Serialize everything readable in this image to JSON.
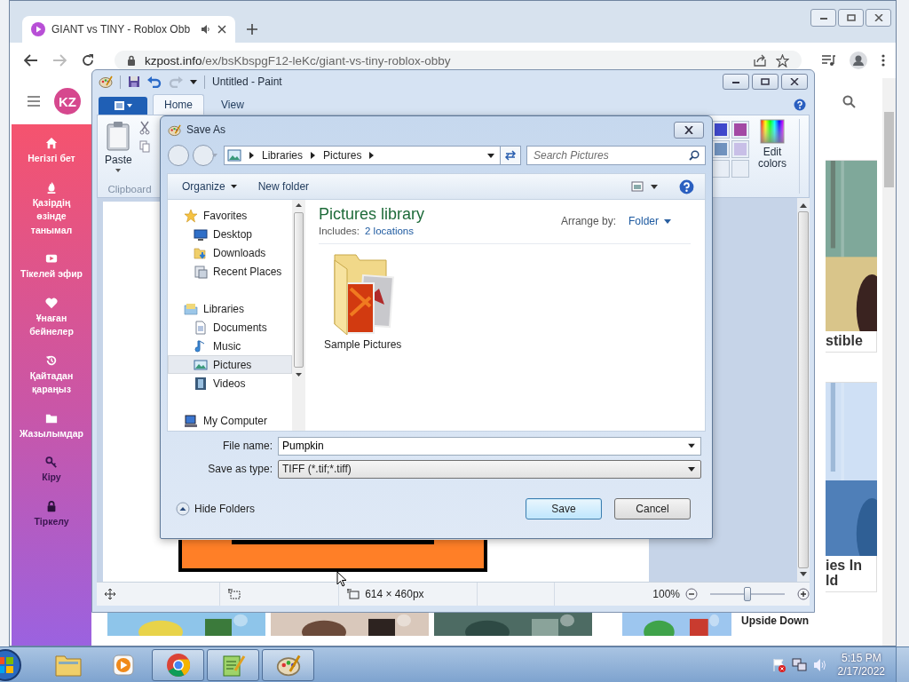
{
  "browser": {
    "tab": {
      "title": "GIANT vs TINY - Roblox Obb"
    },
    "address": {
      "host": "kzpost.info",
      "path": "/ex/bsKbspgF12-leKc/giant-vs-tiny-roblox-obby"
    },
    "site": {
      "logo": "KZ",
      "sidebar": [
        {
          "kind": "home",
          "label": "Негізгі бет"
        },
        {
          "kind": "trending",
          "label": "Қазірдің өзінде танымал"
        },
        {
          "kind": "live",
          "label": "Тікелей эфир"
        },
        {
          "kind": "liked",
          "label": "Ұнаған бейнелер"
        },
        {
          "kind": "history",
          "label": "Қайтадан қараңыз"
        },
        {
          "kind": "subscriptions",
          "label": "Жазылымдар"
        },
        {
          "kind": "login",
          "label": "Кіру"
        },
        {
          "kind": "register",
          "label": "Тіркелу"
        }
      ],
      "cards": [
        {
          "lines": [
            "stible"
          ]
        },
        {
          "lines": [
            "ies In",
            "ld"
          ]
        }
      ],
      "bottom_caption": "Upside Down"
    }
  },
  "paint": {
    "title": "Untitled - Paint",
    "tabs": [
      {
        "label": "Home",
        "selected": true
      },
      {
        "label": "View",
        "selected": false
      }
    ],
    "clipboard": {
      "paste": "Paste",
      "group": "Clipboard"
    },
    "palette": [
      {
        "color": "#3f48cc"
      },
      {
        "color": "#a349a4"
      },
      {
        "color": "#7092be"
      },
      {
        "color": "#c8bfe7"
      }
    ],
    "edit_colors": "Edit colors",
    "status": {
      "size": "614 × 460px",
      "zoom": "100%",
      "zoom_slider": {
        "level": 0.5
      }
    }
  },
  "save_dialog": {
    "title": "Save As",
    "path": [
      "Libraries",
      "Pictures"
    ],
    "search_placeholder": "Search Pictures",
    "toolbar": [
      "Organize",
      "New folder"
    ],
    "nav": [
      {
        "kind": "favorites",
        "label": "Favorites",
        "selected": false,
        "children": [
          {
            "kind": "desktop",
            "label": "Desktop",
            "selected": false
          },
          {
            "kind": "downloads",
            "label": "Downloads",
            "selected": false
          },
          {
            "kind": "recent",
            "label": "Recent Places",
            "selected": false
          }
        ]
      },
      {
        "kind": "libraries",
        "label": "Libraries",
        "selected": false,
        "children": [
          {
            "kind": "documents",
            "label": "Documents",
            "selected": false
          },
          {
            "kind": "music",
            "label": "Music",
            "selected": false
          },
          {
            "kind": "pictures",
            "label": "Pictures",
            "selected": true
          },
          {
            "kind": "videos",
            "label": "Videos",
            "selected": false
          }
        ]
      },
      {
        "kind": "computer",
        "label": "My Computer",
        "selected": false
      }
    ],
    "library": {
      "title": "Pictures library",
      "includes_label": "Includes:",
      "includes_link": "2 locations",
      "arrange_label": "Arrange by:",
      "arrange_value": "Folder"
    },
    "items": [
      {
        "kind": "folder",
        "name": "Sample Pictures"
      }
    ],
    "file_name": {
      "label": "File name:",
      "value": "Pumpkin"
    },
    "save_type": {
      "label": "Save as type:",
      "value": "TIFF (*.tif;*.tiff)"
    },
    "hide_folders": "Hide Folders",
    "buttons": [
      {
        "kind": "primary",
        "label": "Save"
      },
      {
        "kind": "secondary",
        "label": "Cancel"
      }
    ]
  },
  "taskbar": {
    "apps": [
      {
        "kind": "explorer",
        "running": false
      },
      {
        "kind": "media",
        "running": false
      },
      {
        "kind": "chrome",
        "running": true
      },
      {
        "kind": "notepad",
        "running": true
      },
      {
        "kind": "paint",
        "running": true
      }
    ],
    "clock": {
      "time": "5:15 PM",
      "date": "2/17/2022"
    }
  }
}
